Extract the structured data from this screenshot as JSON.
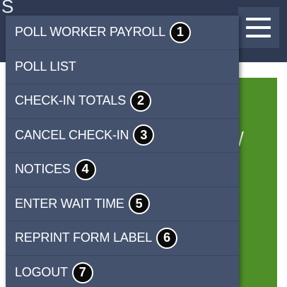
{
  "header": {
    "title_fragment": "S"
  },
  "hamburger": {
    "icon": "hamburger-menu-icon"
  },
  "content": {
    "card_text": "/",
    "card_color": "#4e8f28"
  },
  "menu": {
    "background": "#44526e",
    "items": [
      {
        "label": "POLL WORKER PAYROLL",
        "badge": "1"
      },
      {
        "label": "POLL LIST",
        "badge": ""
      },
      {
        "label": "CHECK-IN TOTALS",
        "badge": "2"
      },
      {
        "label": "CANCEL CHECK-IN",
        "badge": "3"
      },
      {
        "label": "NOTICES",
        "badge": "4"
      },
      {
        "label": "ENTER WAIT TIME",
        "badge": "5"
      },
      {
        "label": "REPRINT FORM LABEL",
        "badge": "6"
      },
      {
        "label": "LOGOUT",
        "badge": "7"
      }
    ]
  }
}
